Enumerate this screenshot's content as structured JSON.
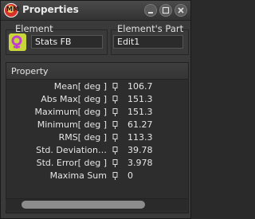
{
  "window": {
    "title": "Properties"
  },
  "element_group": {
    "label": "Element",
    "value": "Stats FB"
  },
  "part_group": {
    "label": "Element's Part",
    "value": "Edit1"
  },
  "grid": {
    "header": "Property",
    "rows": [
      {
        "name": "Mean[ deg ]",
        "value": "106.7"
      },
      {
        "name": "Abs Max[ deg ]",
        "value": "151.3"
      },
      {
        "name": "Maximum[ deg ]",
        "value": "151.3"
      },
      {
        "name": "Minimum[ deg ]",
        "value": "61.27"
      },
      {
        "name": "RMS[ deg ]",
        "value": "113.3"
      },
      {
        "name": "Std. Deviation…",
        "value": "39.78"
      },
      {
        "name": "Std. Error[ deg ]",
        "value": "3.978"
      },
      {
        "name": "Maxima Sum",
        "value": "0"
      }
    ]
  },
  "icons": {
    "app": "app-logo-icon",
    "element": "stats-fb-element-icon",
    "pin": "pin-icon"
  },
  "titlebar_buttons": [
    "minimize",
    "maximize",
    "close"
  ]
}
